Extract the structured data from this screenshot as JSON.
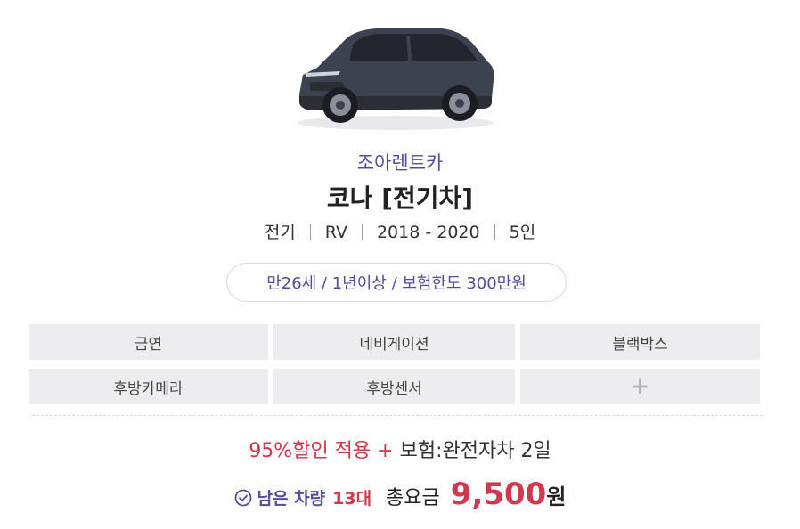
{
  "car": {
    "image_icon": "car-suv-photo",
    "company": "조아렌트카",
    "name": "코나 [전기차]",
    "specs": [
      "전기",
      "RV",
      "2018 - 2020",
      "5인"
    ]
  },
  "condition": {
    "text": "만26세 / 1년이상 / 보험한도 300만원"
  },
  "options": {
    "items": [
      "금연",
      "네비게이션",
      "블랙박스",
      "후방카메라",
      "후방센서"
    ],
    "more_icon": "plus-icon",
    "more_label": "+"
  },
  "promo": {
    "discount": "95%할인 적용 +",
    "insurance": "보험:완전자차 2일"
  },
  "availability": {
    "icon": "check-circle-icon",
    "label": "남은 차량",
    "count": "13대"
  },
  "pricing": {
    "label": "총요금",
    "amount": "9,500",
    "unit": "원"
  },
  "colors": {
    "brand_purple": "#5a4a9a",
    "accent_red": "#d0384e",
    "option_bg": "#ededf0"
  }
}
